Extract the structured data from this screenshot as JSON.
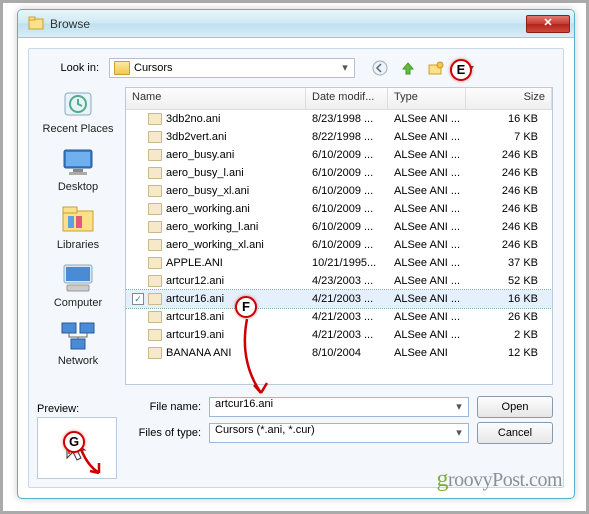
{
  "window": {
    "title": "Browse"
  },
  "lookin": {
    "label": "Look in:",
    "value": "Cursors"
  },
  "columns": {
    "name": "Name",
    "date": "Date modif...",
    "type": "Type",
    "size": "Size"
  },
  "leftbar": [
    {
      "label": "Recent Places"
    },
    {
      "label": "Desktop"
    },
    {
      "label": "Libraries"
    },
    {
      "label": "Computer"
    },
    {
      "label": "Network"
    }
  ],
  "files": [
    {
      "name": "3db2no.ani",
      "date": "8/23/1998 ...",
      "type": "ALSee ANI ...",
      "size": "16 KB",
      "sel": false
    },
    {
      "name": "3db2vert.ani",
      "date": "8/22/1998 ...",
      "type": "ALSee ANI ...",
      "size": "7 KB",
      "sel": false
    },
    {
      "name": "aero_busy.ani",
      "date": "6/10/2009 ...",
      "type": "ALSee ANI ...",
      "size": "246 KB",
      "sel": false
    },
    {
      "name": "aero_busy_l.ani",
      "date": "6/10/2009 ...",
      "type": "ALSee ANI ...",
      "size": "246 KB",
      "sel": false
    },
    {
      "name": "aero_busy_xl.ani",
      "date": "6/10/2009 ...",
      "type": "ALSee ANI ...",
      "size": "246 KB",
      "sel": false
    },
    {
      "name": "aero_working.ani",
      "date": "6/10/2009 ...",
      "type": "ALSee ANI ...",
      "size": "246 KB",
      "sel": false
    },
    {
      "name": "aero_working_l.ani",
      "date": "6/10/2009 ...",
      "type": "ALSee ANI ...",
      "size": "246 KB",
      "sel": false
    },
    {
      "name": "aero_working_xl.ani",
      "date": "6/10/2009 ...",
      "type": "ALSee ANI ...",
      "size": "246 KB",
      "sel": false
    },
    {
      "name": "APPLE.ANI",
      "date": "10/21/1995...",
      "type": "ALSee ANI ...",
      "size": "37 KB",
      "sel": false
    },
    {
      "name": "artcur12.ani",
      "date": "4/23/2003 ...",
      "type": "ALSee ANI ...",
      "size": "52 KB",
      "sel": false
    },
    {
      "name": "artcur16.ani",
      "date": "4/21/2003 ...",
      "type": "ALSee ANI ...",
      "size": "16 KB",
      "sel": true
    },
    {
      "name": "artcur18.ani",
      "date": "4/21/2003 ...",
      "type": "ALSee ANI ...",
      "size": "26 KB",
      "sel": false
    },
    {
      "name": "artcur19.ani",
      "date": "4/21/2003 ...",
      "type": "ALSee ANI ...",
      "size": "2 KB",
      "sel": false
    },
    {
      "name": "BANANA ANI",
      "date": "8/10/2004",
      "type": "ALSee ANI",
      "size": "12 KB",
      "sel": false
    }
  ],
  "filename": {
    "label": "File name:",
    "value": "artcur16.ani"
  },
  "filetype": {
    "label": "Files of type:",
    "value": "Cursors (*.ani, *.cur)"
  },
  "buttons": {
    "open": "Open",
    "cancel": "Cancel"
  },
  "preview": {
    "label": "Preview:"
  },
  "callouts": {
    "e": "E",
    "f": "F",
    "g": "G"
  },
  "watermark": "roovyPost.com"
}
